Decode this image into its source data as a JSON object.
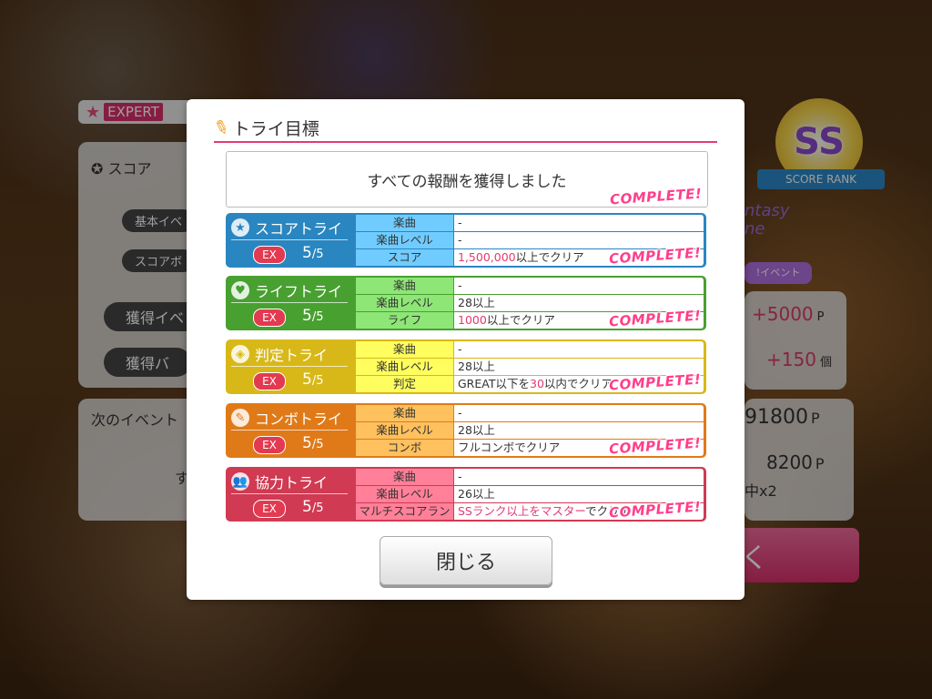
{
  "background": {
    "difficulty_label": "EXPERT",
    "score_label": "スコア",
    "pill_1": "基本イベ",
    "pill_2": "スコアボ",
    "earned_1": "獲得イベ",
    "earned_2": "獲得バ",
    "points_value": "+5000",
    "points_unit": "P",
    "items_value": "+150",
    "items_unit": "個",
    "next_event_label": "次のイベント",
    "total_points": "91800",
    "total_unit": "P",
    "sub_points": "8200",
    "sub_unit": "P",
    "multiplier": "中x2",
    "stray_char": "す",
    "rank": "SS",
    "rank_caption": "SCORE RANK",
    "event_logo_text": "ntasy ne",
    "event_logo_caption": "!イベント",
    "bg_button_char": "く"
  },
  "modal": {
    "title": "トライ目標",
    "all_rewards_message": "すべての報酬を獲得しました",
    "complete_label": "COMPLETE!",
    "close_button": "閉じる",
    "goals": [
      {
        "name": "スコアトライ",
        "icon": "star-icon",
        "color": "#2a86c0",
        "difficulty": "EX",
        "progress": "5",
        "total": "/5",
        "rows": [
          {
            "key": "楽曲",
            "value_pre": "-",
            "value_hl": "",
            "value_post": ""
          },
          {
            "key": "楽曲レベル",
            "value_pre": "-",
            "value_hl": "",
            "value_post": ""
          },
          {
            "key": "スコア",
            "value_pre": "",
            "value_hl": "1,500,000",
            "value_post": "以上でクリア"
          }
        ]
      },
      {
        "name": "ライフトライ",
        "icon": "heart-icon",
        "color": "#48a030",
        "difficulty": "EX",
        "progress": "5",
        "total": "/5",
        "rows": [
          {
            "key": "楽曲",
            "value_pre": "-",
            "value_hl": "",
            "value_post": ""
          },
          {
            "key": "楽曲レベル",
            "value_pre": "28以上",
            "value_hl": "",
            "value_post": ""
          },
          {
            "key": "ライフ",
            "value_pre": "",
            "value_hl": "1000",
            "value_post": "以上でクリア"
          }
        ]
      },
      {
        "name": "判定トライ",
        "icon": "diamond-target-icon",
        "color": "#d8b818",
        "difficulty": "EX",
        "progress": "5",
        "total": "/5",
        "rows": [
          {
            "key": "楽曲",
            "value_pre": "-",
            "value_hl": "",
            "value_post": ""
          },
          {
            "key": "楽曲レベル",
            "value_pre": "28以上",
            "value_hl": "",
            "value_post": ""
          },
          {
            "key": "判定",
            "value_pre": "GREAT以下を",
            "value_hl": "30",
            "value_post": "以内でクリア"
          }
        ]
      },
      {
        "name": "コンボトライ",
        "icon": "brush-icon",
        "color": "#e07a18",
        "difficulty": "EX",
        "progress": "5",
        "total": "/5",
        "rows": [
          {
            "key": "楽曲",
            "value_pre": "-",
            "value_hl": "",
            "value_post": ""
          },
          {
            "key": "楽曲レベル",
            "value_pre": "28以上",
            "value_hl": "",
            "value_post": ""
          },
          {
            "key": "コンボ",
            "value_pre": "フルコンボでクリア",
            "value_hl": "",
            "value_post": ""
          }
        ]
      },
      {
        "name": "協力トライ",
        "icon": "people-icon",
        "color": "#d03a52",
        "difficulty": "EX",
        "progress": "5",
        "total": "/5",
        "rows": [
          {
            "key": "楽曲",
            "value_pre": "-",
            "value_hl": "",
            "value_post": ""
          },
          {
            "key": "楽曲レベル",
            "value_pre": "26以上",
            "value_hl": "",
            "value_post": ""
          },
          {
            "key": "マルチスコアランク",
            "value_pre": "",
            "value_hl": "SSランク以上をマスター",
            "value_post": "でクリア"
          }
        ]
      }
    ]
  }
}
